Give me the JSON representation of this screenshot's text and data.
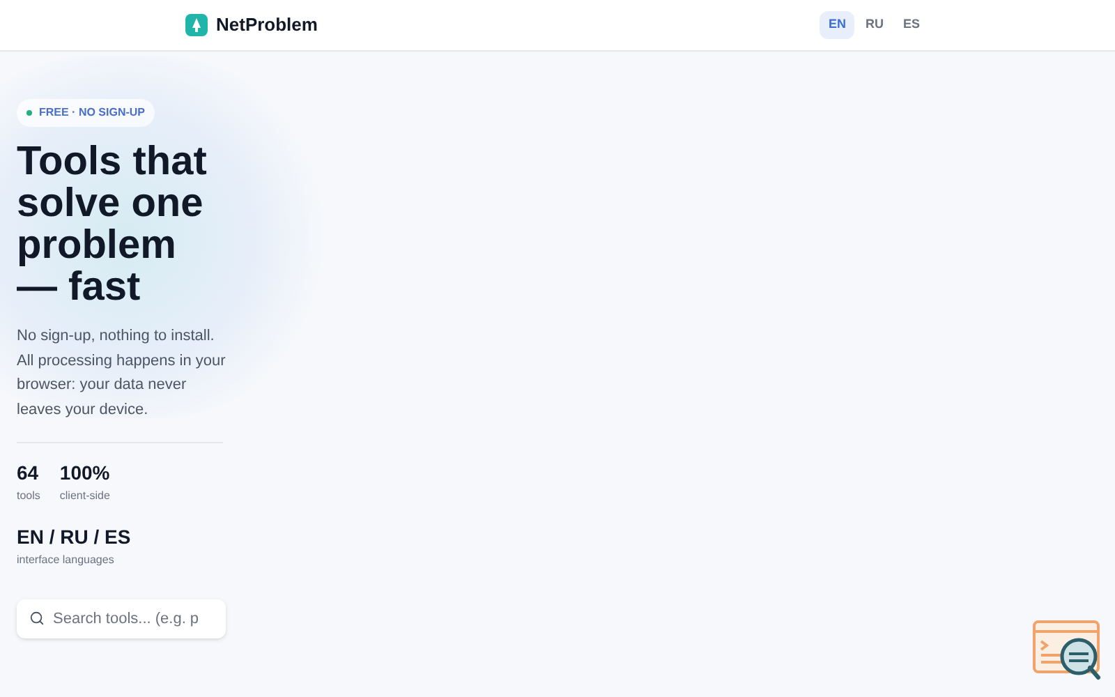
{
  "header": {
    "brand": "NetProblem",
    "languages": [
      {
        "label": "EN",
        "selected": true
      },
      {
        "label": "RU",
        "selected": false
      },
      {
        "label": "ES",
        "selected": false
      }
    ]
  },
  "hero": {
    "badge": "FREE · NO SIGN-UP",
    "title": "Tools that solve one problem — fast",
    "description": "No sign-up, nothing to install. All processing happens in your browser: your data never leaves your device.",
    "stats": [
      {
        "value": "64",
        "label": "tools"
      },
      {
        "value": "100%",
        "label": "client-side"
      }
    ],
    "languages_stat": {
      "value": "EN / RU / ES",
      "label": "interface languages"
    },
    "search": {
      "placeholder": "Search tools... (e.g. p"
    }
  }
}
